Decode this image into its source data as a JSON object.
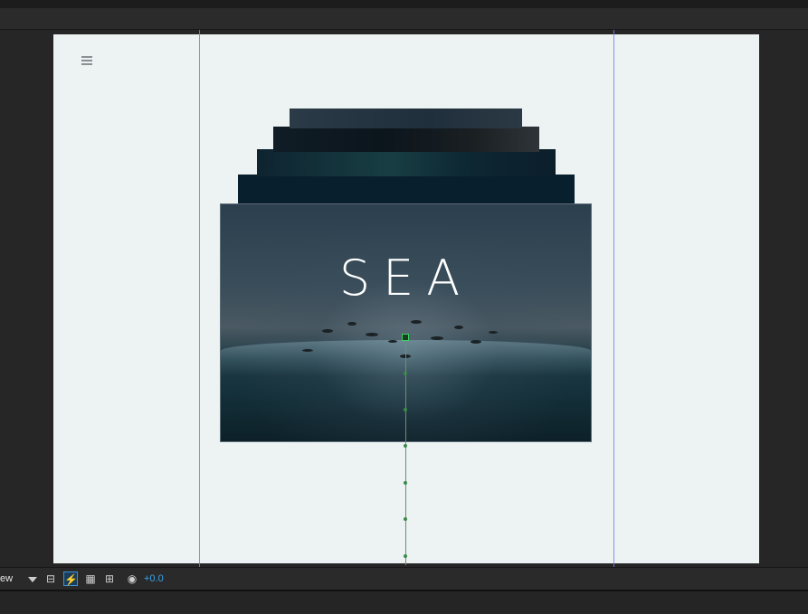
{
  "composition": {
    "title_text": "SEA",
    "menu_icon": "hamburger-menu-icon"
  },
  "statusbar": {
    "view_label": "ew",
    "exposure_value": "+0.0",
    "icons": [
      "view-dropdown-caret-icon",
      "region-of-interest-icon",
      "fast-preview-icon",
      "toggle-transparency-grid-icon",
      "view-hierarchy-icon",
      "reset-exposure-icon"
    ]
  },
  "colors": {
    "accent_blue": "#3aa3e8",
    "guide_line": "#7a7ae8",
    "motion_path": "#3bd45e"
  }
}
